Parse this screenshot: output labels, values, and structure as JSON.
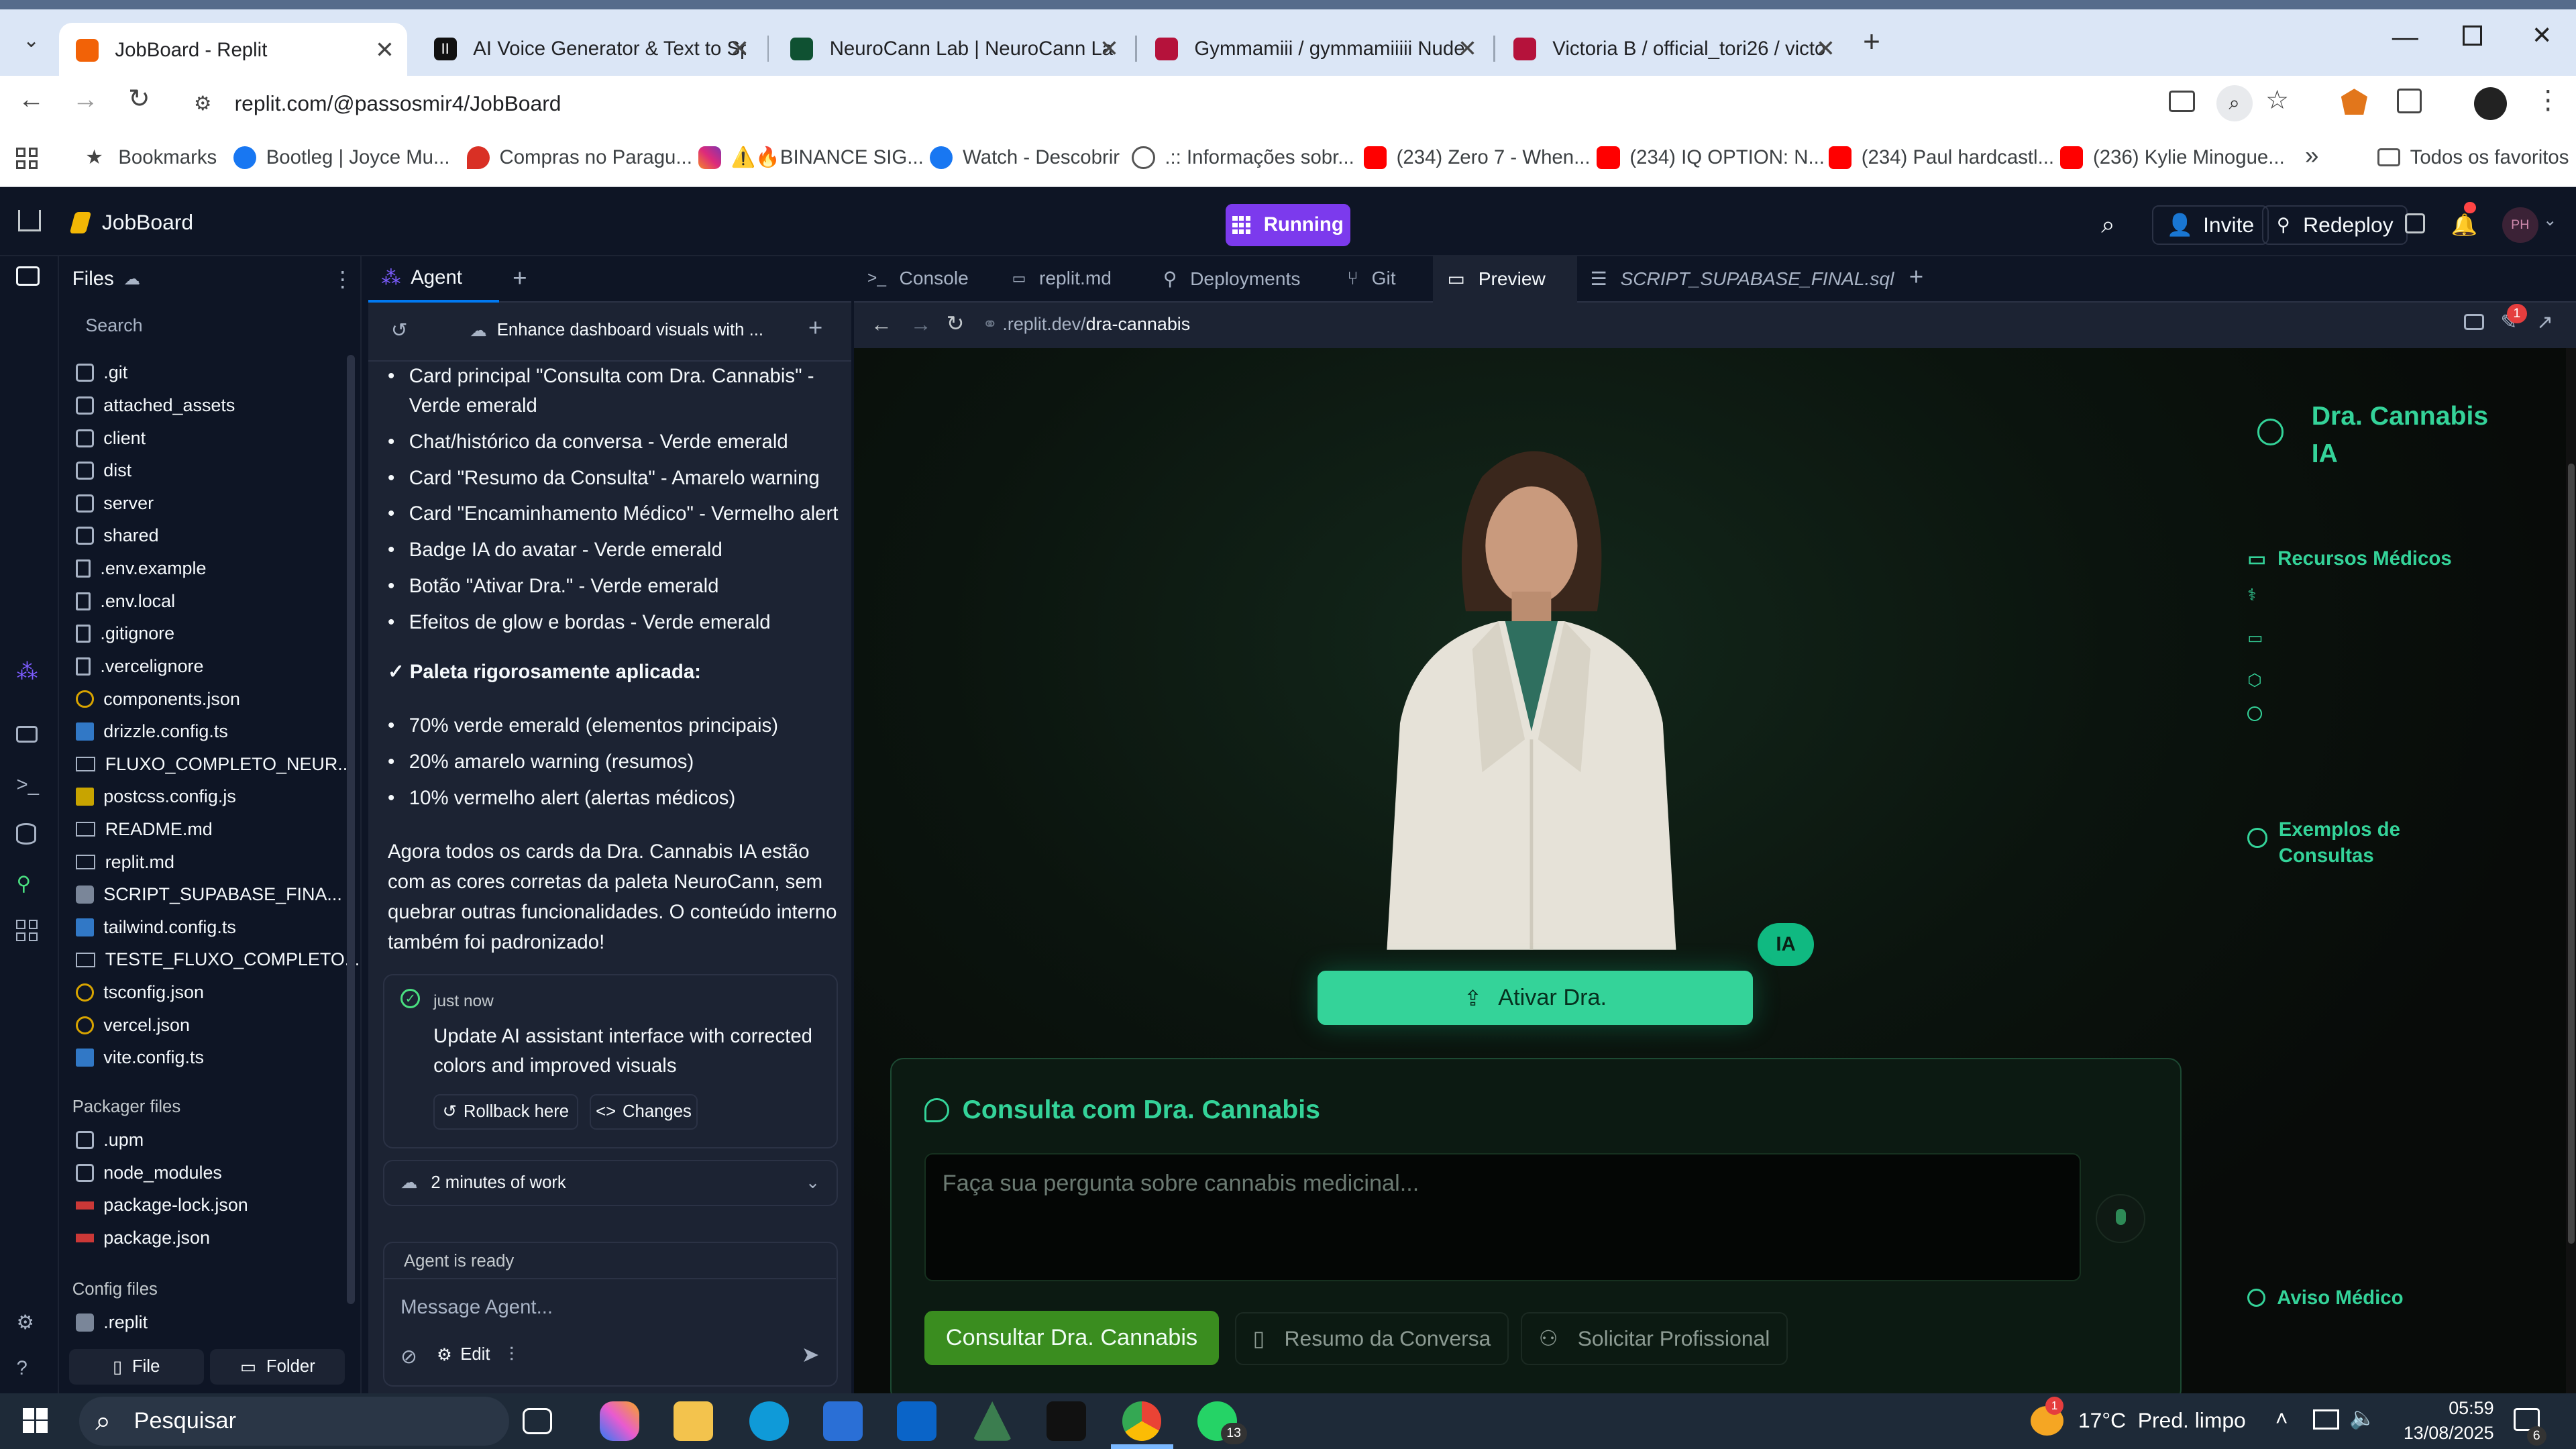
{
  "browser": {
    "tabs": [
      {
        "title": "JobBoard - Replit",
        "active": true
      },
      {
        "title": "AI Voice Generator & Text to Sp",
        "active": false
      },
      {
        "title": "NeuroCann Lab | NeuroCann La",
        "active": false
      },
      {
        "title": "Gymmamiii / gymmamiiiii Nude",
        "active": false
      },
      {
        "title": "Victoria B / official_tori26 / victo",
        "active": false
      }
    ],
    "url": "replit.com/@passosmir4/JobBoard",
    "bookmarks": [
      "Bookmarks",
      "Bootleg | Joyce Mu...",
      "Compras no Paragu...",
      "⚠️🔥BINANCE SIG...",
      "Watch - Descobrir",
      ".:: Informações sobr...",
      "(234) Zero 7 - When...",
      "(234) IQ OPTION: N...",
      "(234) Paul hardcastl...",
      "(236) Kylie Minogue..."
    ],
    "all_bookmarks": "Todos os favoritos"
  },
  "replit": {
    "project": "JobBoard",
    "status": "Running",
    "invite": "Invite",
    "redeploy": "Redeploy",
    "avatar": "PH",
    "colors": {
      "running": "#7c3aed",
      "accent": "#34d399"
    }
  },
  "files": {
    "title": "Files",
    "search_placeholder": "Search",
    "items": [
      {
        "name": ".git",
        "icon": "folder"
      },
      {
        "name": "attached_assets",
        "icon": "folder"
      },
      {
        "name": "client",
        "icon": "folder"
      },
      {
        "name": "dist",
        "icon": "folder"
      },
      {
        "name": "server",
        "icon": "folder"
      },
      {
        "name": "shared",
        "icon": "folder"
      },
      {
        "name": ".env.example",
        "icon": "file"
      },
      {
        "name": ".env.local",
        "icon": "file"
      },
      {
        "name": ".gitignore",
        "icon": "file"
      },
      {
        "name": ".vercelignore",
        "icon": "file"
      },
      {
        "name": "components.json",
        "icon": "json"
      },
      {
        "name": "drizzle.config.ts",
        "icon": "ts"
      },
      {
        "name": "FLUXO_COMPLETO_NEUR...",
        "icon": "md"
      },
      {
        "name": "postcss.config.js",
        "icon": "js"
      },
      {
        "name": "README.md",
        "icon": "md"
      },
      {
        "name": "replit.md",
        "icon": "md"
      },
      {
        "name": "SCRIPT_SUPABASE_FINA...",
        "icon": "db"
      },
      {
        "name": "tailwind.config.ts",
        "icon": "ts"
      },
      {
        "name": "TESTE_FLUXO_COMPLETO...",
        "icon": "md"
      },
      {
        "name": "tsconfig.json",
        "icon": "json"
      },
      {
        "name": "vercel.json",
        "icon": "json"
      },
      {
        "name": "vite.config.ts",
        "icon": "ts"
      }
    ],
    "packager_title": "Packager files",
    "packager_items": [
      {
        "name": ".upm",
        "icon": "folder"
      },
      {
        "name": "node_modules",
        "icon": "folder"
      },
      {
        "name": "package-lock.json",
        "icon": "pkg"
      },
      {
        "name": "package.json",
        "icon": "pkg"
      }
    ],
    "config_title": "Config files",
    "config_items": [
      {
        "name": ".replit",
        "icon": "replit"
      }
    ],
    "file_button": "File",
    "folder_button": "Folder"
  },
  "agent": {
    "tab": "Agent",
    "thread_title": "Enhance dashboard visuals with ...",
    "bullets": [
      "Card principal \"Consulta com Dra. Cannabis\" - Verde emerald",
      "Chat/histórico da conversa - Verde emerald",
      "Card \"Resumo da Consulta\" - Amarelo warning",
      "Card \"Encaminhamento Médico\" - Vermelho alert",
      "Badge IA do avatar - Verde emerald",
      "Botão \"Ativar Dra.\" - Verde emerald",
      "Efeitos de glow e bordas - Verde emerald"
    ],
    "palette_heading": "✓ Paleta rigorosamente aplicada:",
    "palette_bullets": [
      "70% verde emerald (elementos principais)",
      "20% amarelo warning (resumos)",
      "10% vermelho alert (alertas médicos)"
    ],
    "summary": "Agora todos os cards da Dra. Cannabis IA estão com as cores corretas da paleta NeuroCann, sem quebrar outras funcionalidades. O conteúdo interno também foi padronizado!",
    "checkpoint_time": "just now",
    "checkpoint_text": "Update AI assistant interface with corrected colors and improved visuals",
    "rollback": "Rollback here",
    "changes": "Changes",
    "work_time": "2 minutes of work",
    "status": "Agent is ready",
    "input_placeholder": "Message Agent...",
    "edit": "Edit"
  },
  "workspace": {
    "tabs": [
      "Console",
      "replit.md",
      "Deployments",
      "Git",
      "Preview",
      "SCRIPT_SUPABASE_FINAL.sql"
    ],
    "active_tab": "Preview",
    "preview_url_prefix": ".replit.dev/",
    "preview_url_path": "dra-cannabis",
    "notification_count": "1"
  },
  "app": {
    "brand": "Dra. Cannabis IA",
    "badge": "IA",
    "activate_button": "Ativar Dra.",
    "card_title": "Consulta com Dra. Cannabis",
    "question_placeholder": "Faça sua pergunta sobre cannabis medicinal...",
    "consult_button": "Consultar Dra. Cannabis",
    "summary_button": "Resumo da Conversa",
    "request_button": "Solicitar Profissional",
    "resources_title": "Recursos Médicos",
    "examples_title": "Exemplos de Consultas",
    "warning_title": "Aviso Médico",
    "colors": {
      "emerald": "#34d399",
      "brand_green": "#3a8d1f",
      "bg": "#080b09"
    }
  },
  "taskbar": {
    "search": "Pesquisar",
    "weather": "17°C  Pred. limpo",
    "weather_badge": "1",
    "time": "05:59",
    "date": "13/08/2025",
    "whatsapp_badge": "13",
    "notif_badge": "6"
  }
}
